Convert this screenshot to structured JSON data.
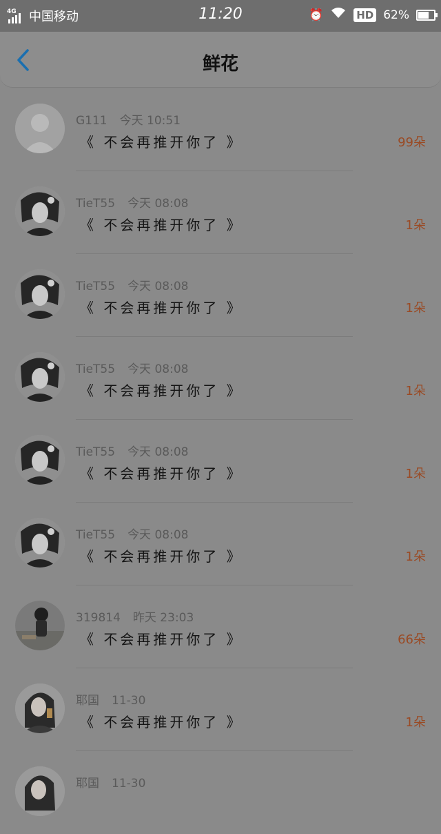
{
  "status_bar": {
    "network": "4G",
    "carrier": "中国移动",
    "time": "11:20",
    "hd": "HD",
    "battery": "62%",
    "icons": [
      "alarm-icon",
      "wifi-icon",
      "battery-charging-icon"
    ]
  },
  "header": {
    "title": "鲜花",
    "back_icon": "chevron-left-icon"
  },
  "items": [
    {
      "user": "G111",
      "time": "今天 10:51",
      "message": "《 不会再推开你了 》",
      "count": "99朵",
      "avatar": "default"
    },
    {
      "user": "TieT55",
      "time": "今天 08:08",
      "message": "《 不会再推开你了 》",
      "count": "1朵",
      "avatar": "anime"
    },
    {
      "user": "TieT55",
      "time": "今天 08:08",
      "message": "《 不会再推开你了 》",
      "count": "1朵",
      "avatar": "anime"
    },
    {
      "user": "TieT55",
      "time": "今天 08:08",
      "message": "《 不会再推开你了 》",
      "count": "1朵",
      "avatar": "anime"
    },
    {
      "user": "TieT55",
      "time": "今天 08:08",
      "message": "《 不会再推开你了 》",
      "count": "1朵",
      "avatar": "anime"
    },
    {
      "user": "TieT55",
      "time": "今天 08:08",
      "message": "《 不会再推开你了 》",
      "count": "1朵",
      "avatar": "anime"
    },
    {
      "user": "319814",
      "time": "昨天 23:03",
      "message": "《 不会再推开你了 》",
      "count": "66朵",
      "avatar": "photo"
    },
    {
      "user": "耶国",
      "time": "11-30",
      "message": "《 不会再推开你了 》",
      "count": "1朵",
      "avatar": "girl"
    },
    {
      "user": "耶国",
      "time": "11-30",
      "message": "",
      "count": "",
      "avatar": "girl"
    }
  ],
  "colors": {
    "accent_back": "#1a6fb0",
    "count": "#9a4a24",
    "overlay_bg": "#8a8a8a"
  }
}
